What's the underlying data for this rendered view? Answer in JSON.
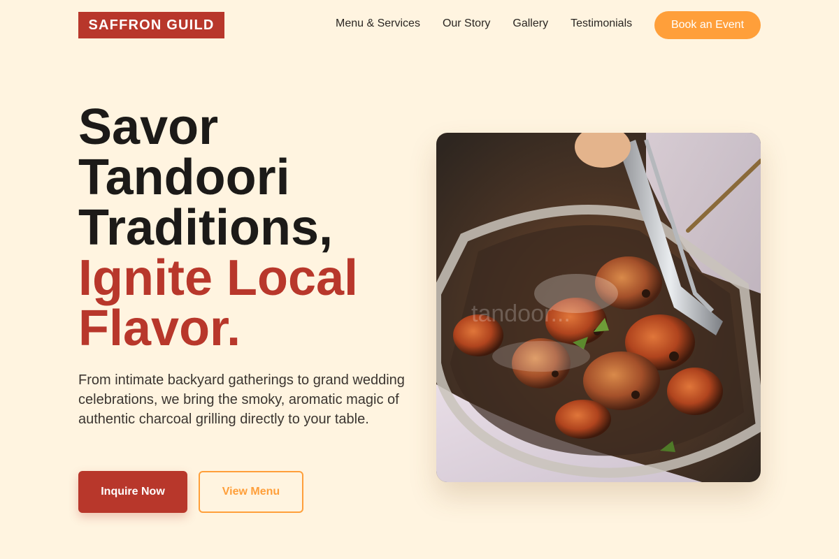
{
  "brand": {
    "name": "SAFFRON GUILD"
  },
  "nav": {
    "items": [
      {
        "label": "Menu & Services"
      },
      {
        "label": "Our Story"
      },
      {
        "label": "Gallery"
      },
      {
        "label": "Testimonials"
      }
    ],
    "cta_label": "Book an Event"
  },
  "hero": {
    "headline_dark": [
      "Savor",
      "Tandoori",
      "Traditions,"
    ],
    "headline_accent": [
      "Ignite Local",
      "Flavor."
    ],
    "subtext": "From intimate backyard gatherings to grand wedding celebrations, we bring the smoky, aromatic magic of authentic charcoal grilling directly to your table.",
    "primary_button": "Inquire Now",
    "secondary_button": "View Menu",
    "image_watermark": "tandoor..."
  },
  "colors": {
    "background": "#fff4e0",
    "brand_red": "#b8372b",
    "accent_orange": "#ff9f3a",
    "text_dark": "#1c1a18"
  }
}
